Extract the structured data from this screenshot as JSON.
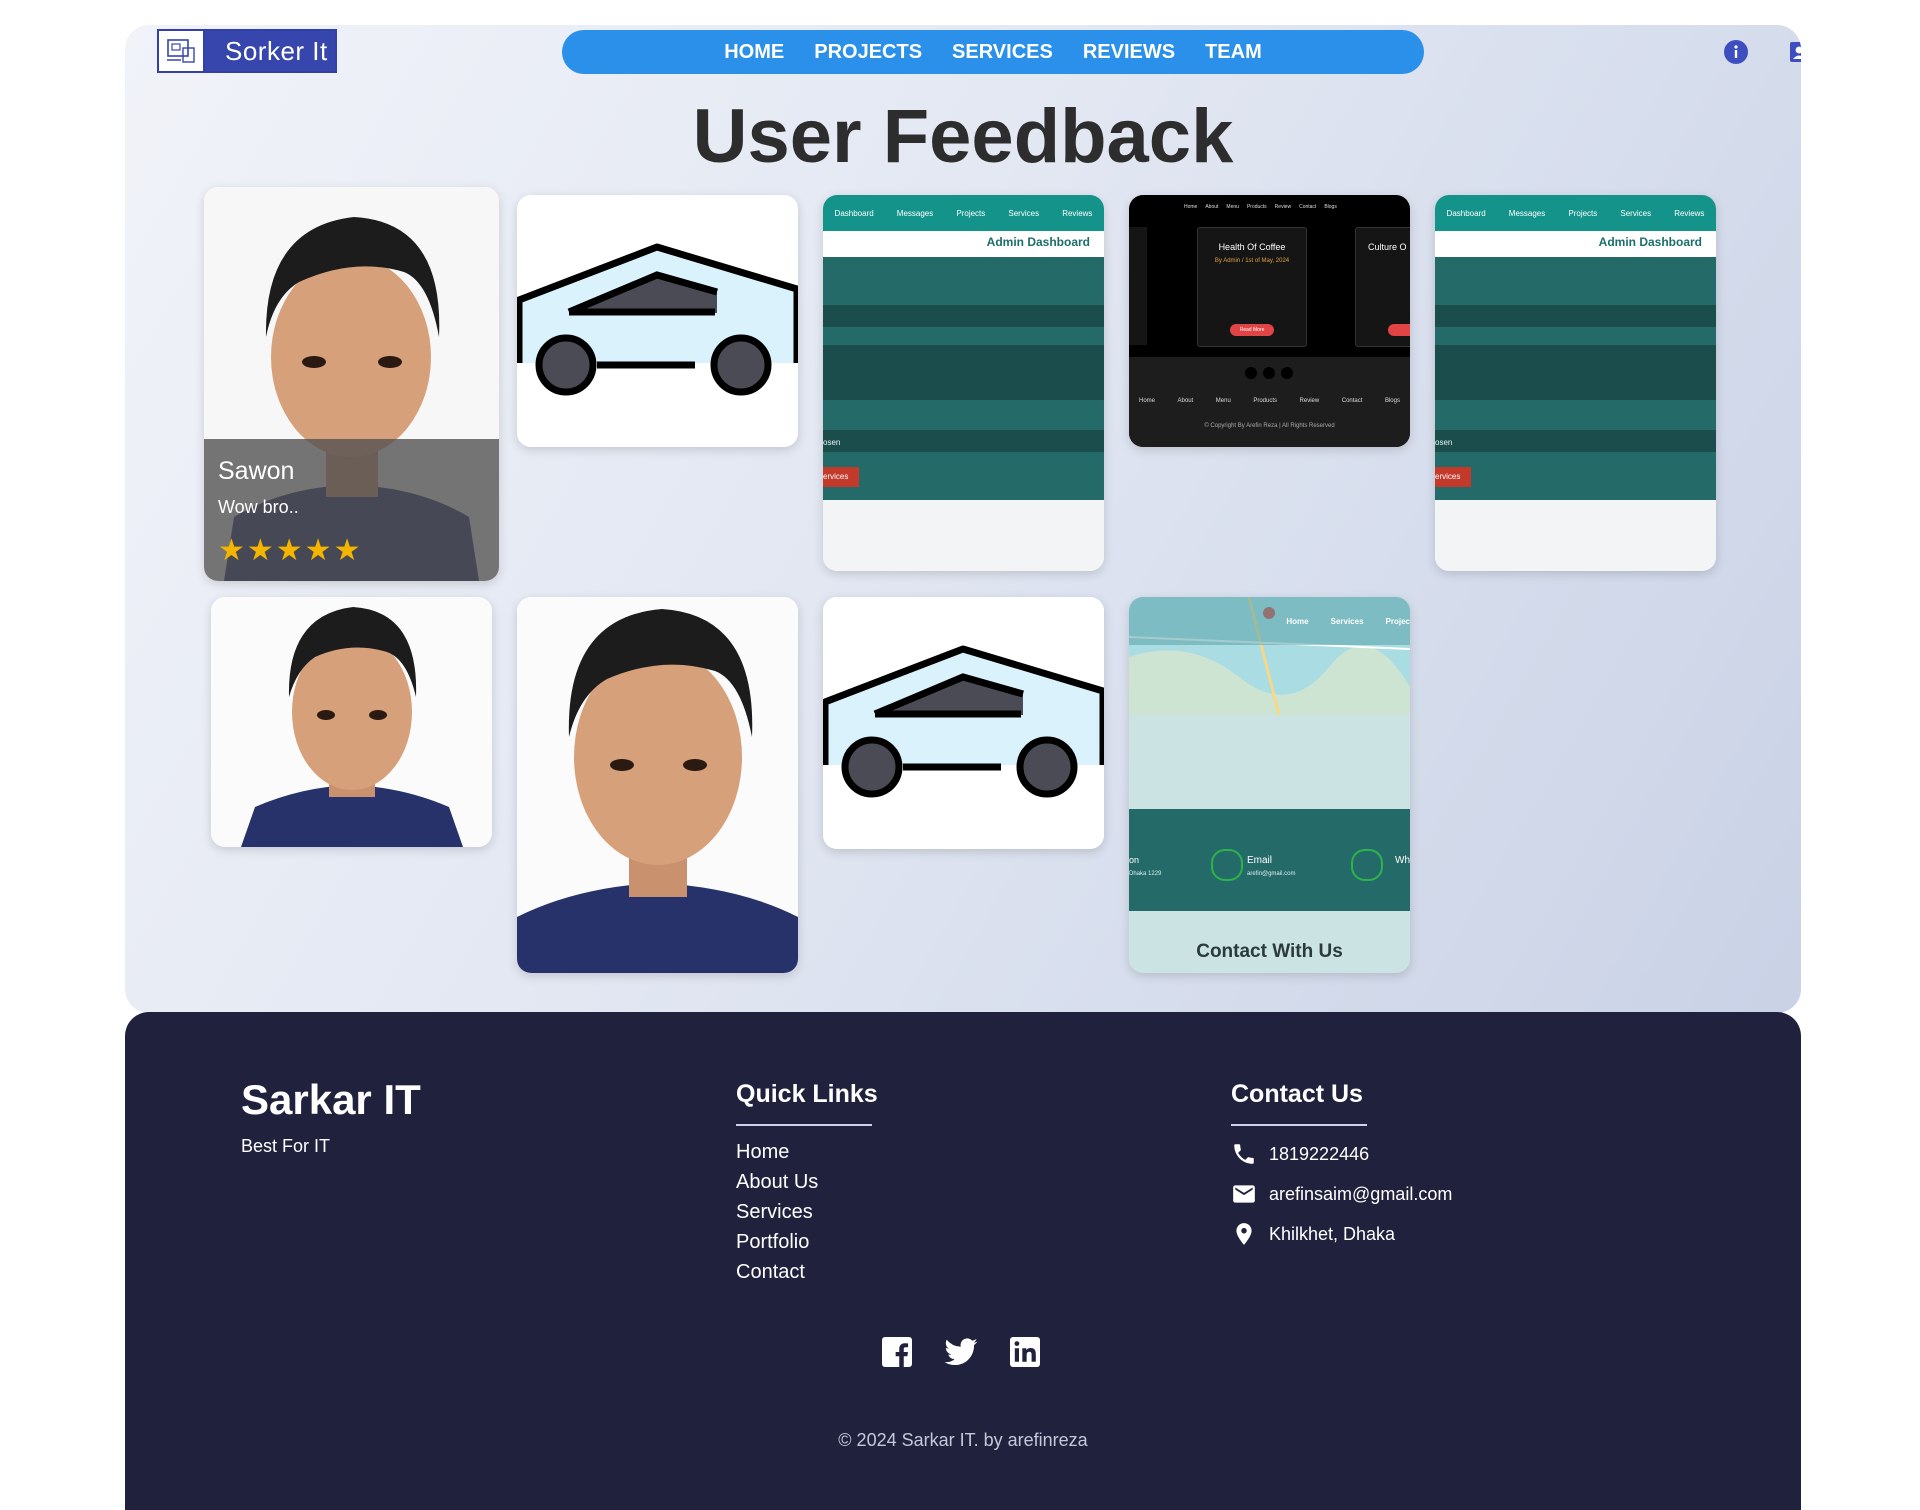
{
  "header": {
    "logo_text": "Sorker It",
    "nav": [
      "HOME",
      "PROJECTS",
      "SERVICES",
      "REVIEWS",
      "TEAM"
    ],
    "icons": [
      "info-icon",
      "contact-card-icon"
    ]
  },
  "feedback": {
    "title": "User Feedback",
    "featured_review": {
      "name": "Sawon",
      "text": "Wow bro..",
      "rating": 5,
      "stars": "★★★★★"
    },
    "thumb_dashboard": {
      "nav": [
        "Dashboard",
        "Messages",
        "Projects",
        "Services",
        "Reviews"
      ],
      "title": "Admin Dashboard",
      "side_text": "osen",
      "badge": "ervices"
    },
    "thumb_coffee": {
      "nav": [
        "Home",
        "About",
        "Menu",
        "Products",
        "Review",
        "Contact",
        "Blogs"
      ],
      "card1_title": "Health Of Coffee",
      "card1_meta": "By Admin / 1st of May, 2024",
      "card2_title": "Culture O",
      "button": "Read More",
      "footer_nav": [
        "Home",
        "About",
        "Menu",
        "Products",
        "Review",
        "Contact",
        "Blogs"
      ],
      "copyright": "© Copyright By Arefin Reza | All Rights Reserved"
    },
    "thumb_contact": {
      "map_nav": [
        "Home",
        "Services",
        "Projec"
      ],
      "email_label": "Email",
      "email_value": "arefin@gmail.com",
      "left_label": "on",
      "left_value": "Dhaka 1229",
      "right_label": "Wh",
      "caption": "Contact With Us"
    }
  },
  "footer": {
    "brand": "Sarkar IT",
    "tagline": "Best For IT",
    "quick_links_title": "Quick Links",
    "quick_links": [
      "Home",
      "About Us",
      "Services",
      "Portfolio",
      "Contact"
    ],
    "contact_title": "Contact Us",
    "phone": "1819222446",
    "email": "arefinsaim@gmail.com",
    "address": "Khilkhet, Dhaka",
    "social": [
      "facebook-icon",
      "twitter-icon",
      "linkedin-icon"
    ],
    "copyright": "© 2024 Sarkar IT. by arefinreza"
  },
  "colors": {
    "nav_blue": "#2b90e9",
    "logo_blue": "#3646ad",
    "teal": "#1f6b68",
    "footer_bg": "#20213d",
    "star": "#f4b400"
  }
}
